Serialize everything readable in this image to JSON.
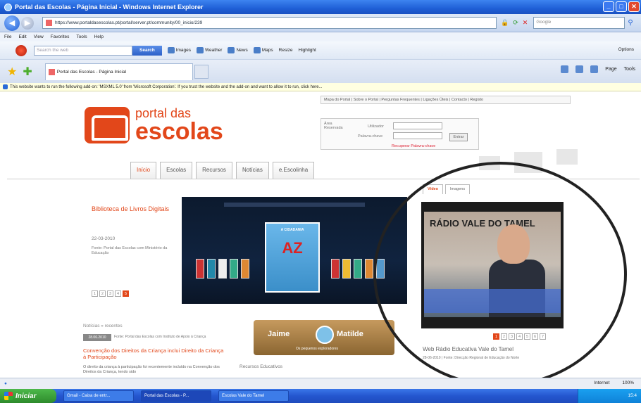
{
  "window": {
    "title": "Portal das Escolas - Página Inicial - Windows Internet Explorer"
  },
  "address_bar": {
    "url": "https://www.portaldasescolas.pt/portal/server.pt/community/00_inicio/239",
    "search_placeholder": "Google"
  },
  "menu_bar": {
    "items": [
      "File",
      "Edit",
      "View",
      "Favorites",
      "Tools",
      "Help"
    ]
  },
  "search_toolbar": {
    "placeholder": "Search the web",
    "search_label": "Search",
    "items": [
      "Images",
      "Weather",
      "News",
      "Maps",
      "Resize",
      "Highlight"
    ],
    "options_label": "Options"
  },
  "tabs": {
    "active_tab": "Portal das Escolas - Página Inicial",
    "commands": [
      "Page",
      "Tools"
    ]
  },
  "info_bar": {
    "text": "This website wants to run the following add-on: 'MSXML 5.0' from 'Microsoft Corporation'. If you trust the website and the add-on and want to allow it to run, click here..."
  },
  "portal": {
    "top_links": "Mapa do Portal | Sobre o Portal | Perguntas Frequentes | Ligações Úteis | Contacto | Registo",
    "logo_small": "portal das",
    "logo_big": "escolas",
    "login": {
      "area_label": "Área Reservada",
      "user_label": "Utilizador",
      "password_label": "Palavra-chave",
      "enter_label": "Entrar",
      "recover_label": "Recuperar Palavra-chave"
    },
    "nav": [
      "Início",
      "Escolas",
      "Recursos",
      "Notícias",
      "e.Escolinha"
    ],
    "feature": {
      "title": "Biblioteca de Livros Digitais",
      "date": "22-03-2010",
      "source": "Fonte: Portal das Escolas com Ministério da Educação",
      "book_title": "A CIDADANIA",
      "book_letters": "AZ",
      "pager": [
        "1",
        "2",
        "3",
        "4",
        "5"
      ],
      "active_page": "5"
    },
    "news": {
      "heading": "Notícias » recentes",
      "date": "28.06.2010",
      "source": "Fonte: Portal das Escolas com Instituto de Apoio à Criança",
      "title": "Convenção dos Direitos da Criança inclui Direito da Criança à Participação",
      "body": "O direito da criança à participação foi recentemente incluído na Convenção dos Direitos da Criança, tendo sido"
    },
    "banner": {
      "left": "Jaime",
      "right": "Matilde",
      "sub": "Os pequenos exploradores"
    },
    "resources_label": "Recursos Educativos",
    "media": {
      "tabs": [
        "Vídeo",
        "Imagens"
      ],
      "overlay_text": "RÁDIO VALE DO TAMEL",
      "pager": [
        "1",
        "2",
        "3",
        "4",
        "5",
        "6",
        "7"
      ],
      "active_page": "1",
      "title": "Web Rádio Educativa Vale do Tamel",
      "source": "28-06-2010 | Fonte: Direcção Regional de Educação do Norte"
    }
  },
  "status_bar": {
    "zone": "Internet",
    "zoom": "100%"
  },
  "taskbar": {
    "start_label": "Iniciar",
    "tasks": [
      "Gmail - Caixa de entr...",
      "Portal das Escolas - P...",
      "Escolas Vale do Tamel"
    ],
    "clock": "15:4"
  }
}
